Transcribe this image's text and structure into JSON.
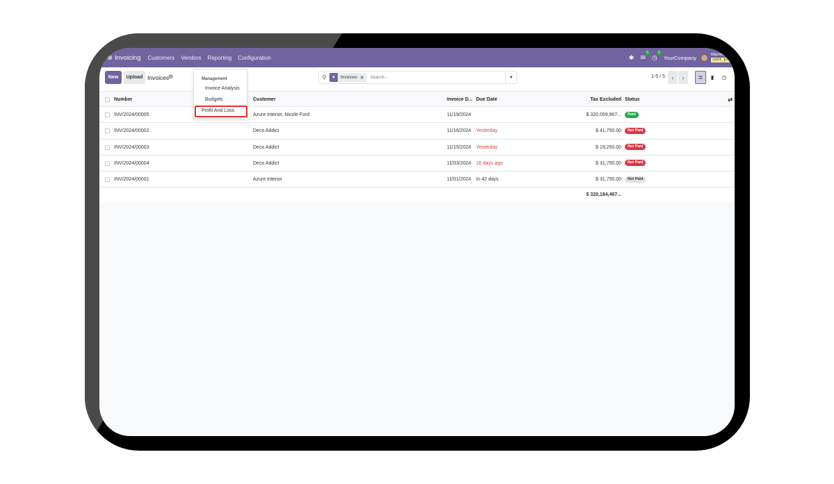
{
  "navbar": {
    "app_name": "Invoicing",
    "menu": [
      "Customers",
      "Vendors",
      "Reporting",
      "Configuration"
    ],
    "company": "YourCompany",
    "user_name": "Mitchell Ad...",
    "db_name": "cool_prof...",
    "messages_count": "5",
    "activities_count": "2",
    "color": "#71639e"
  },
  "control": {
    "new_label": "New",
    "upload_label": "Upload",
    "breadcrumb": "Invoices",
    "search": {
      "facet_label": "Invoices",
      "placeholder": "Search..."
    },
    "pager": "1-5 / 5"
  },
  "dropdown": {
    "section": "Management",
    "items": [
      "Invoice Analysis",
      "Budgets",
      "Profit And Loss"
    ],
    "highlighted": "Profit And Loss"
  },
  "table": {
    "columns": [
      "Number",
      "Customer",
      "Invoice D...",
      "Due Date",
      "Tax Excluded",
      "Status"
    ],
    "rows": [
      {
        "number": "INV/2024/00005",
        "customer": "Azure Interior, Nicole Ford",
        "invoice_date": "11/19/2024",
        "due": "",
        "tax": "$ 320,059,967...",
        "status": "Paid"
      },
      {
        "number": "INV/2024/00002",
        "customer": "Deco Addict",
        "invoice_date": "11/16/2024",
        "due": "Yesterday",
        "tax": "$ 41,750.00",
        "status": "Not Paid"
      },
      {
        "number": "INV/2024/00003",
        "customer": "Deco Addict",
        "invoice_date": "11/15/2024",
        "due": "Yesterday",
        "tax": "$ 19,250.00",
        "status": "Not Paid"
      },
      {
        "number": "INV/2024/00004",
        "customer": "Deco Addict",
        "invoice_date": "11/03/2024",
        "due": "16 days ago",
        "tax": "$ 31,750.00",
        "status": "Not Paid"
      },
      {
        "number": "INV/2024/00001",
        "customer": "Azure Interior",
        "invoice_date": "11/01/2024",
        "due": "In 42 days",
        "tax": "$ 31,750.00",
        "status": "Not Paid"
      }
    ],
    "total": "$ 320,184,467..."
  },
  "colors": {
    "accent": "#71639e",
    "overdue": "#d23f3a",
    "paid": "#28a745",
    "not_paid": "#dc3545",
    "highlight_box": "#e2302c"
  }
}
